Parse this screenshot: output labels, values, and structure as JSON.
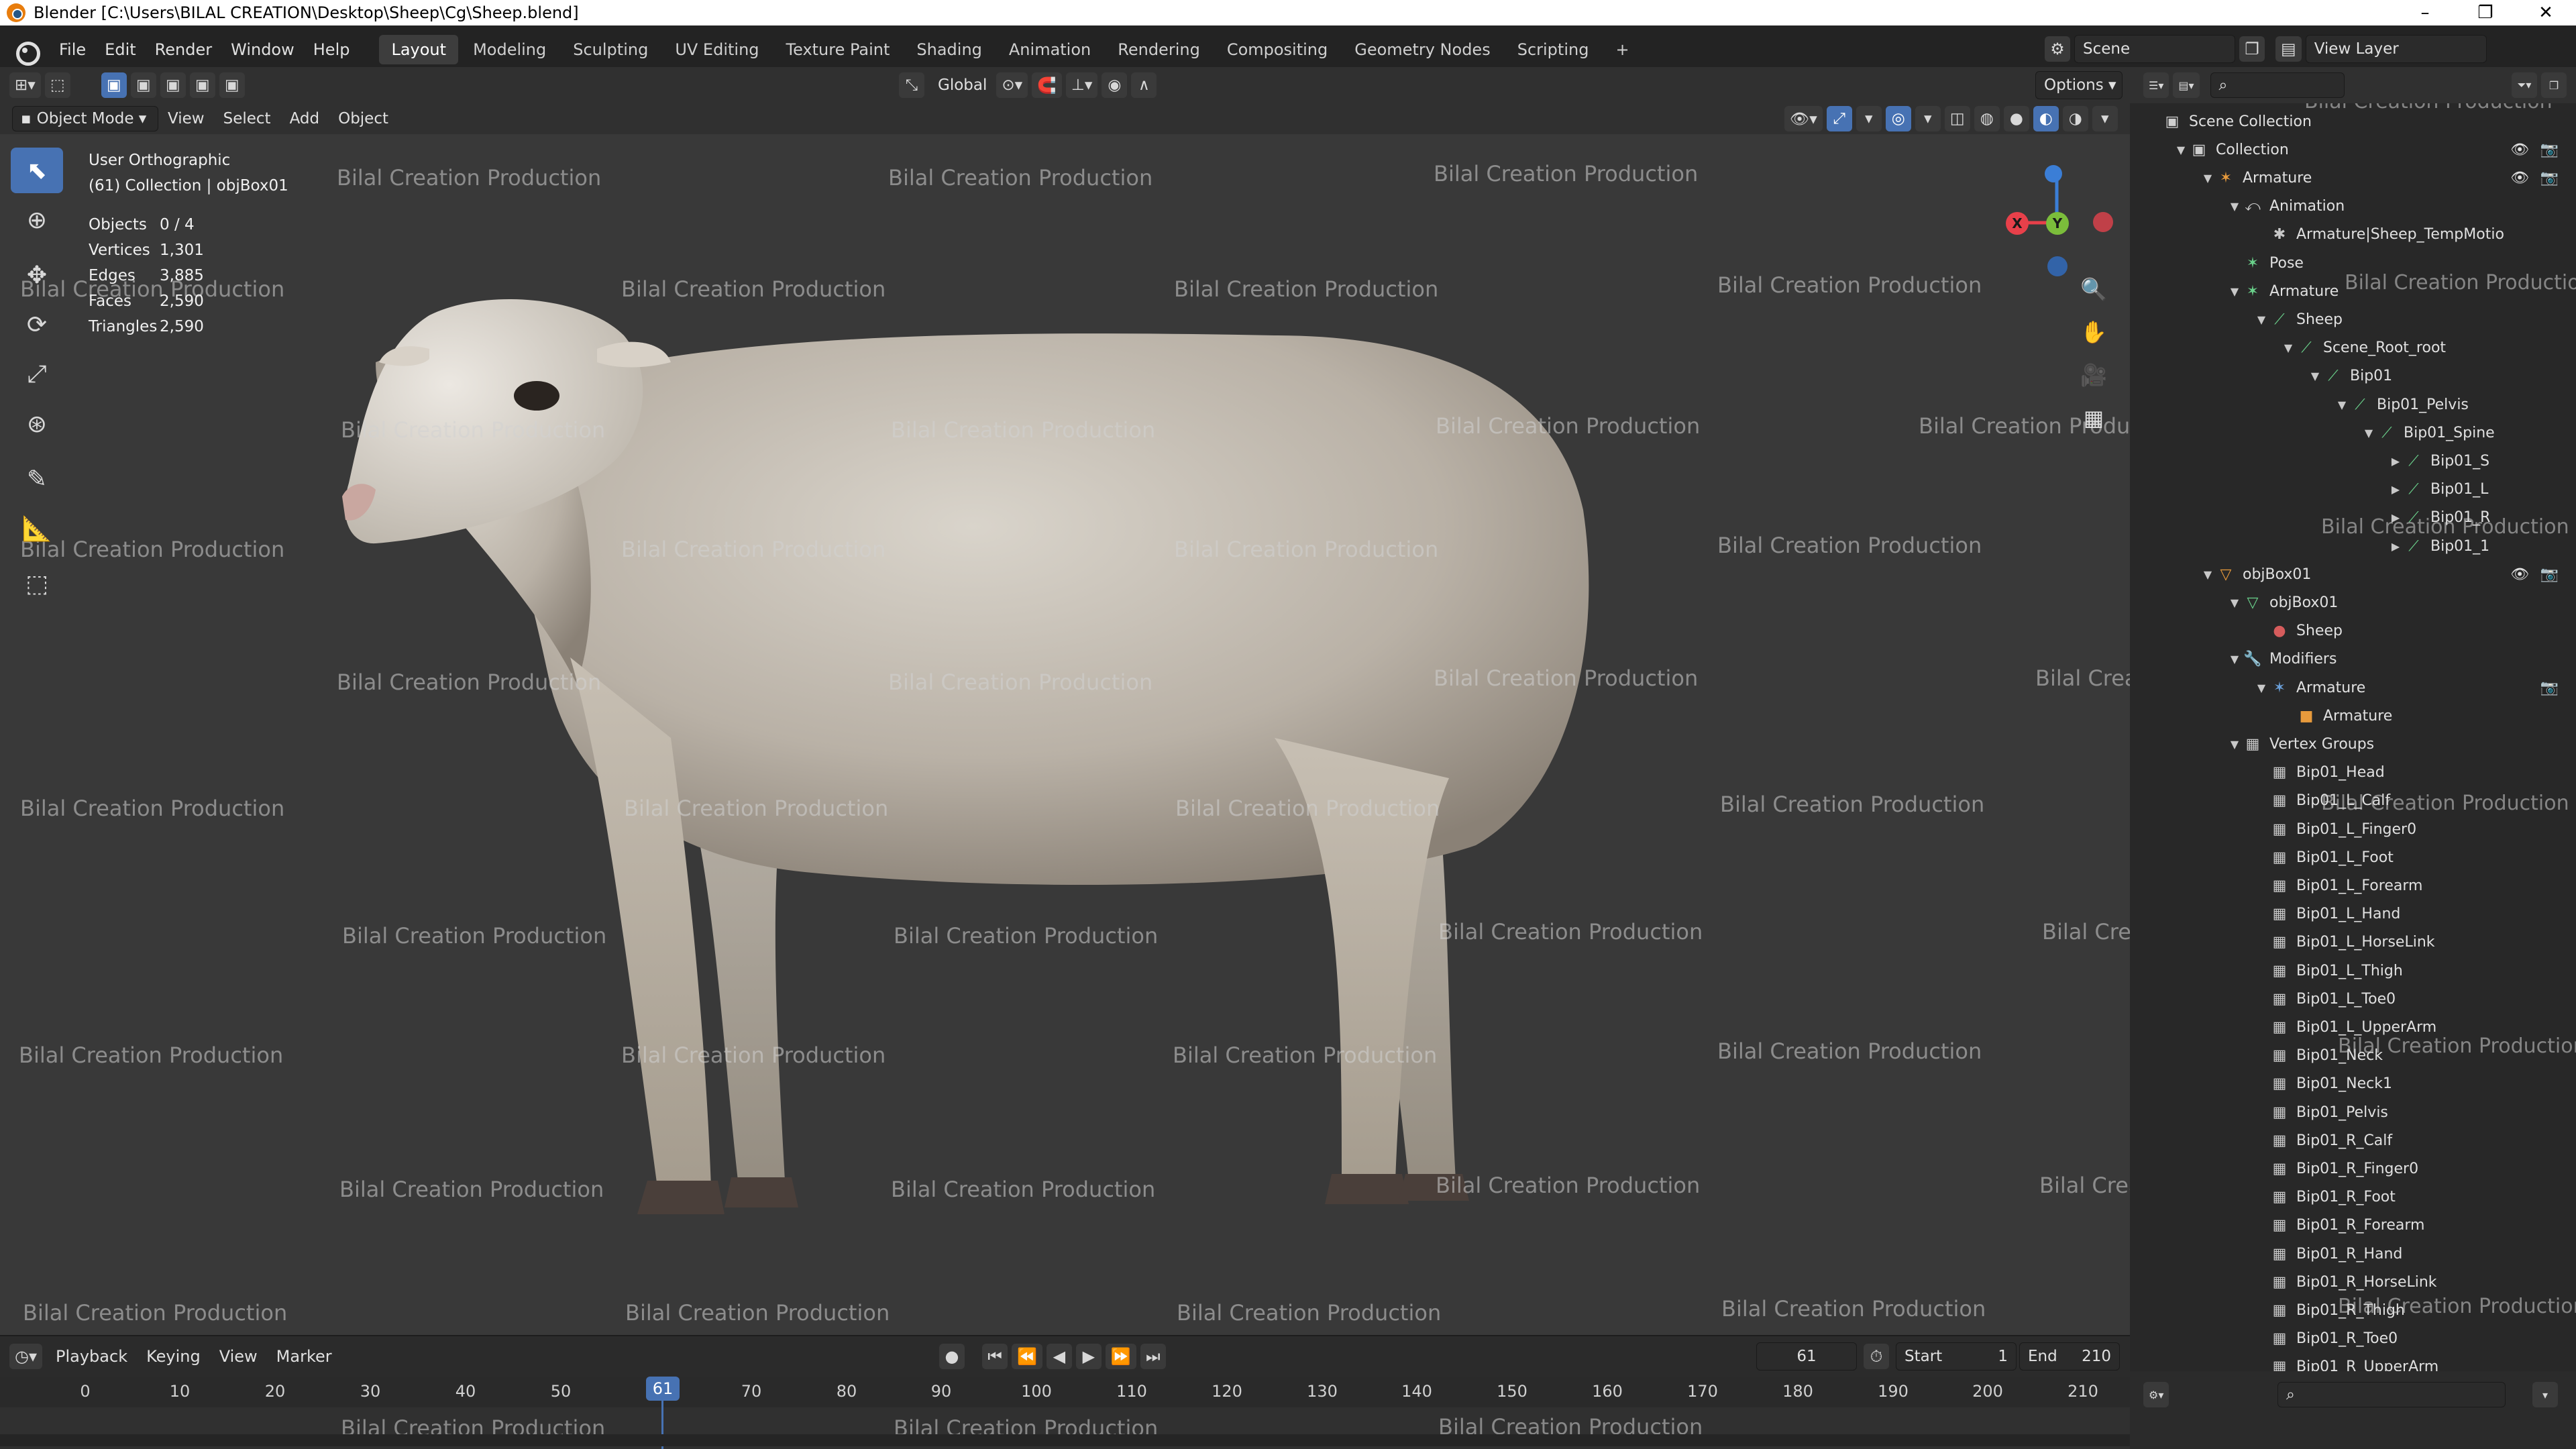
{
  "window": {
    "title": "Blender [C:\\Users\\BILAL CREATION\\Desktop\\Sheep\\Cg\\Sheep.blend]",
    "controls": [
      "–",
      "❐",
      "✕"
    ]
  },
  "menu": [
    "File",
    "Edit",
    "Render",
    "Window",
    "Help"
  ],
  "workspaces": [
    "Layout",
    "Modeling",
    "Sculpting",
    "UV Editing",
    "Texture Paint",
    "Shading",
    "Animation",
    "Rendering",
    "Compositing",
    "Geometry Nodes",
    "Scripting"
  ],
  "active_workspace": "Layout",
  "scene": {
    "label": "Scene",
    "view_layer": "View Layer"
  },
  "viewport_header": {
    "mode": "Object Mode",
    "menus": [
      "View",
      "Select",
      "Add",
      "Object"
    ],
    "orientation": "Global",
    "options": "Options"
  },
  "viewport_info": {
    "view": "User Orthographic",
    "collection": "(61) Collection | objBox01",
    "stats": [
      {
        "k": "Objects",
        "v": "0 / 4"
      },
      {
        "k": "Vertices",
        "v": "1,301"
      },
      {
        "k": "Edges",
        "v": "3,885"
      },
      {
        "k": "Faces",
        "v": "2,590"
      },
      {
        "k": "Triangles",
        "v": "2,590"
      }
    ]
  },
  "watermark": "Bilal Creation Production",
  "gizmo": {
    "x": "X",
    "y": "Y",
    "z": "Z"
  },
  "timeline": {
    "menus": [
      "Playback",
      "Keying",
      "View",
      "Marker"
    ],
    "current_frame": "61",
    "start_label": "Start",
    "start": "1",
    "end_label": "End",
    "end": "210",
    "ticks": [
      "0",
      "10",
      "20",
      "30",
      "40",
      "50",
      "70",
      "80",
      "90",
      "100",
      "110",
      "120",
      "130",
      "140",
      "150",
      "160",
      "170",
      "180",
      "190",
      "200",
      "210"
    ]
  },
  "outliner": {
    "rows": [
      {
        "label": "Scene Collection",
        "depth": 0,
        "icon": "▣",
        "color": "#cfcfcf",
        "arrow": ""
      },
      {
        "label": "Collection",
        "depth": 1,
        "icon": "▣",
        "color": "#cfcfcf",
        "arrow": "▼"
      },
      {
        "label": "Armature",
        "depth": 2,
        "icon": "✶",
        "color": "#e79a3c",
        "arrow": "▼"
      },
      {
        "label": "Animation",
        "depth": 3,
        "icon": "⤺",
        "color": "#c8c8c8",
        "arrow": "▼"
      },
      {
        "label": "Armature|Sheep_TempMotio",
        "depth": 4,
        "icon": "✱",
        "color": "#c8c8c8",
        "arrow": ""
      },
      {
        "label": "Pose",
        "depth": 3,
        "icon": "✶",
        "color": "#6ad18b",
        "arrow": ""
      },
      {
        "label": "Armature",
        "depth": 3,
        "icon": "✶",
        "color": "#6ad18b",
        "arrow": "▼"
      },
      {
        "label": "Sheep",
        "depth": 4,
        "icon": "⟋",
        "color": "#6ad18b",
        "arrow": "▼"
      },
      {
        "label": "Scene_Root_root",
        "depth": 5,
        "icon": "⟋",
        "color": "#6ad18b",
        "arrow": "▼"
      },
      {
        "label": "Bip01",
        "depth": 6,
        "icon": "⟋",
        "color": "#6ad18b",
        "arrow": "▼"
      },
      {
        "label": "Bip01_Pelvis",
        "depth": 7,
        "icon": "⟋",
        "color": "#6ad18b",
        "arrow": "▼"
      },
      {
        "label": "Bip01_Spine",
        "depth": 8,
        "icon": "⟋",
        "color": "#6ad18b",
        "arrow": "▼"
      },
      {
        "label": "Bip01_S",
        "depth": 9,
        "icon": "⟋",
        "color": "#6ad18b",
        "arrow": "▶"
      },
      {
        "label": "Bip01_L",
        "depth": 9,
        "icon": "⟋",
        "color": "#6ad18b",
        "arrow": "▶"
      },
      {
        "label": "Bip01_R",
        "depth": 9,
        "icon": "⟋",
        "color": "#6ad18b",
        "arrow": "▶"
      },
      {
        "label": "Bip01_1",
        "depth": 9,
        "icon": "⟋",
        "color": "#6ad18b",
        "arrow": "▶"
      },
      {
        "label": "objBox01",
        "depth": 2,
        "icon": "▽",
        "color": "#e79a3c",
        "arrow": "▼"
      },
      {
        "label": "objBox01",
        "depth": 3,
        "icon": "▽",
        "color": "#6ad18b",
        "arrow": "▼"
      },
      {
        "label": "Sheep",
        "depth": 4,
        "icon": "●",
        "color": "#d65c5c",
        "arrow": ""
      },
      {
        "label": "Modifiers",
        "depth": 3,
        "icon": "🔧",
        "color": "#6a9fd8",
        "arrow": "▼"
      },
      {
        "label": "Armature",
        "depth": 4,
        "icon": "✶",
        "color": "#6a9fd8",
        "arrow": "▼"
      },
      {
        "label": "Armature",
        "depth": 5,
        "icon": "■",
        "color": "#e79a3c",
        "arrow": ""
      },
      {
        "label": "Vertex Groups",
        "depth": 3,
        "icon": "▦",
        "color": "#c8c8c8",
        "arrow": "▼"
      },
      {
        "label": "Bip01_Head",
        "depth": 4,
        "icon": "▦",
        "color": "#c8c8c8",
        "arrow": ""
      },
      {
        "label": "Bip01_L_Calf",
        "depth": 4,
        "icon": "▦",
        "color": "#c8c8c8",
        "arrow": ""
      },
      {
        "label": "Bip01_L_Finger0",
        "depth": 4,
        "icon": "▦",
        "color": "#c8c8c8",
        "arrow": ""
      },
      {
        "label": "Bip01_L_Foot",
        "depth": 4,
        "icon": "▦",
        "color": "#c8c8c8",
        "arrow": ""
      },
      {
        "label": "Bip01_L_Forearm",
        "depth": 4,
        "icon": "▦",
        "color": "#c8c8c8",
        "arrow": ""
      },
      {
        "label": "Bip01_L_Hand",
        "depth": 4,
        "icon": "▦",
        "color": "#c8c8c8",
        "arrow": ""
      },
      {
        "label": "Bip01_L_HorseLink",
        "depth": 4,
        "icon": "▦",
        "color": "#c8c8c8",
        "arrow": ""
      },
      {
        "label": "Bip01_L_Thigh",
        "depth": 4,
        "icon": "▦",
        "color": "#c8c8c8",
        "arrow": ""
      },
      {
        "label": "Bip01_L_Toe0",
        "depth": 4,
        "icon": "▦",
        "color": "#c8c8c8",
        "arrow": ""
      },
      {
        "label": "Bip01_L_UpperArm",
        "depth": 4,
        "icon": "▦",
        "color": "#c8c8c8",
        "arrow": ""
      },
      {
        "label": "Bip01_Neck",
        "depth": 4,
        "icon": "▦",
        "color": "#c8c8c8",
        "arrow": ""
      },
      {
        "label": "Bip01_Neck1",
        "depth": 4,
        "icon": "▦",
        "color": "#c8c8c8",
        "arrow": ""
      },
      {
        "label": "Bip01_Pelvis",
        "depth": 4,
        "icon": "▦",
        "color": "#c8c8c8",
        "arrow": ""
      },
      {
        "label": "Bip01_R_Calf",
        "depth": 4,
        "icon": "▦",
        "color": "#c8c8c8",
        "arrow": ""
      },
      {
        "label": "Bip01_R_Finger0",
        "depth": 4,
        "icon": "▦",
        "color": "#c8c8c8",
        "arrow": ""
      },
      {
        "label": "Bip01_R_Foot",
        "depth": 4,
        "icon": "▦",
        "color": "#c8c8c8",
        "arrow": ""
      },
      {
        "label": "Bip01_R_Forearm",
        "depth": 4,
        "icon": "▦",
        "color": "#c8c8c8",
        "arrow": ""
      },
      {
        "label": "Bip01_R_Hand",
        "depth": 4,
        "icon": "▦",
        "color": "#c8c8c8",
        "arrow": ""
      },
      {
        "label": "Bip01_R_HorseLink",
        "depth": 4,
        "icon": "▦",
        "color": "#c8c8c8",
        "arrow": ""
      },
      {
        "label": "Bip01_R_Thigh",
        "depth": 4,
        "icon": "▦",
        "color": "#c8c8c8",
        "arrow": ""
      },
      {
        "label": "Bip01_R_Toe0",
        "depth": 4,
        "icon": "▦",
        "color": "#c8c8c8",
        "arrow": ""
      },
      {
        "label": "Bip01_R_UpperArm",
        "depth": 4,
        "icon": "▦",
        "color": "#c8c8c8",
        "arrow": ""
      }
    ]
  },
  "colors": {
    "accent": "#4772b3",
    "axis_x": "#e8404a",
    "axis_y": "#7bbd3b",
    "axis_z": "#3b7ed6"
  }
}
